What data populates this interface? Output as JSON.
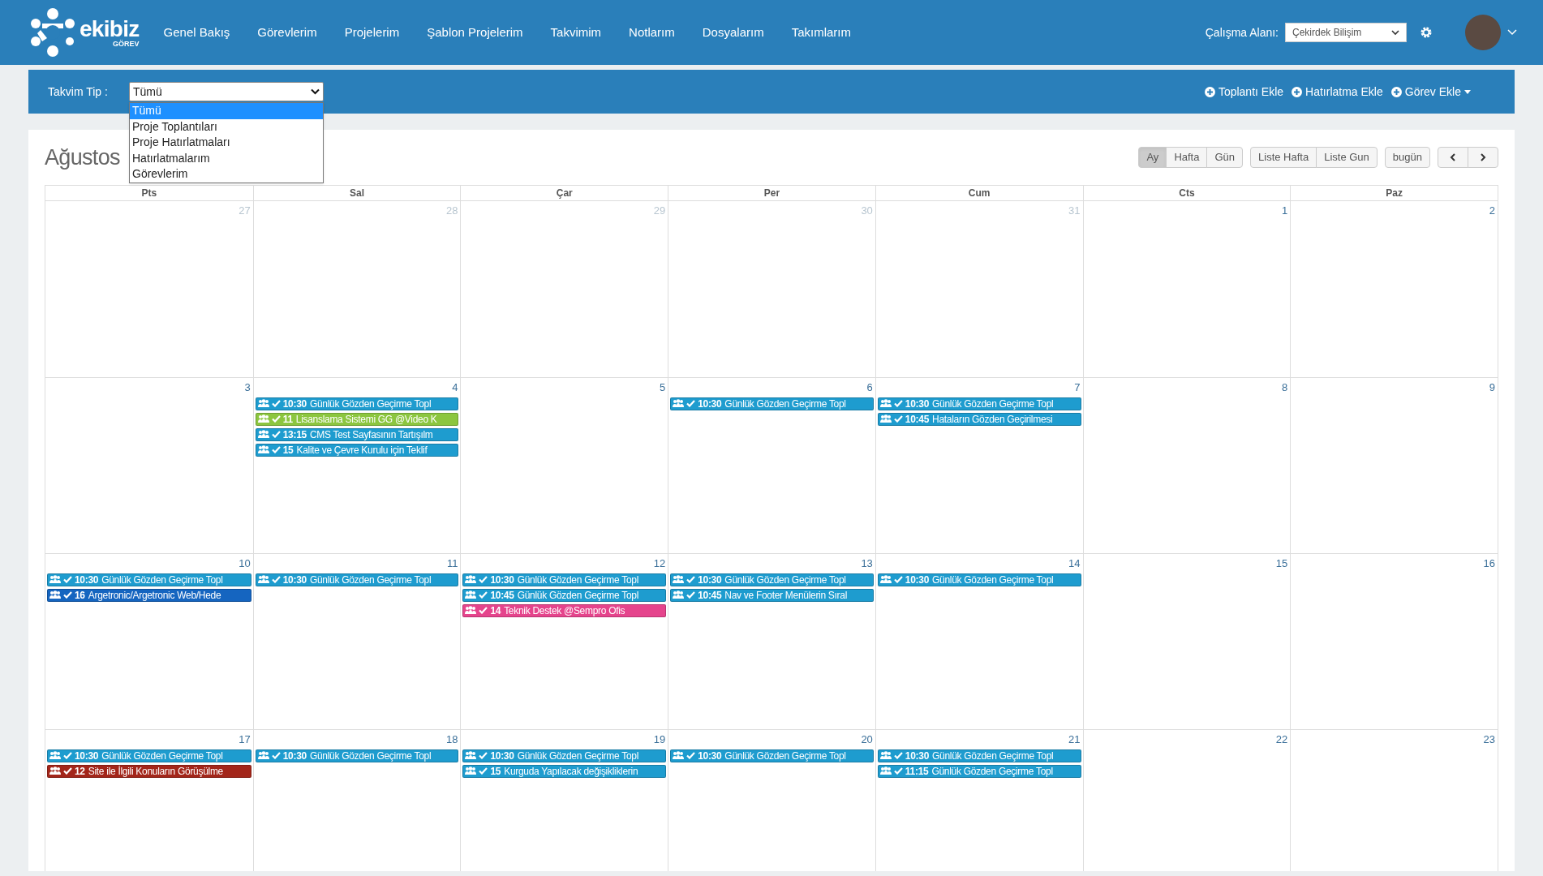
{
  "logo": {
    "name": "ekibiz",
    "subtitle": "GÖREV"
  },
  "nav": [
    {
      "label": "Genel Bakış"
    },
    {
      "label": "Görevlerim"
    },
    {
      "label": "Projelerim"
    },
    {
      "label": "Şablon Projelerim"
    },
    {
      "label": "Takvimim"
    },
    {
      "label": "Notlarım"
    },
    {
      "label": "Dosyalarım"
    },
    {
      "label": "Takımlarım"
    }
  ],
  "workspace": {
    "label": "Çalışma Alanı:",
    "value": "Çekirdek Bilişim"
  },
  "toolbar": {
    "label": "Takvim Tip :",
    "select_value": "Tümü",
    "options": [
      {
        "label": "Tümü",
        "selected": true
      },
      {
        "label": "Proje Toplantıları",
        "selected": false
      },
      {
        "label": "Proje Hatırlatmaları",
        "selected": false
      },
      {
        "label": "Hatırlatmalarım",
        "selected": false
      },
      {
        "label": "Görevlerim",
        "selected": false
      }
    ],
    "actions": [
      {
        "label": "Toplantı Ekle",
        "dropdown": false
      },
      {
        "label": "Hatırlatma Ekle",
        "dropdown": false
      },
      {
        "label": "Görev Ekle",
        "dropdown": true
      }
    ]
  },
  "calendar": {
    "title": "Ağustos",
    "button_groups": [
      [
        {
          "label": "Ay",
          "kind": "text",
          "selected": true
        },
        {
          "label": "Hafta",
          "kind": "text",
          "selected": false
        },
        {
          "label": "Gün",
          "kind": "text",
          "selected": false
        }
      ],
      [
        {
          "label": "Liste Hafta",
          "kind": "text",
          "selected": false
        },
        {
          "label": "Liste Gun",
          "kind": "text",
          "selected": false
        }
      ],
      [
        {
          "label": "bugün",
          "kind": "text",
          "selected": false
        }
      ],
      [
        {
          "kind": "prev",
          "selected": false
        },
        {
          "kind": "next",
          "selected": false
        }
      ]
    ],
    "weekdays": [
      "Pts",
      "Sal",
      "Çar",
      "Per",
      "Cum",
      "Cts",
      "Paz"
    ],
    "weeks": [
      {
        "days": [
          {
            "number": "27",
            "other_month": true
          },
          {
            "number": "28",
            "other_month": true
          },
          {
            "number": "29",
            "other_month": true
          },
          {
            "number": "30",
            "other_month": true
          },
          {
            "number": "31",
            "other_month": true
          },
          {
            "number": "1",
            "other_month": false
          },
          {
            "number": "2",
            "other_month": false
          }
        ]
      },
      {
        "days": [
          {
            "number": "3",
            "other_month": false
          },
          {
            "number": "4",
            "other_month": false,
            "events": [
              {
                "time": "10:30",
                "title": "Günlük Gözden Geçirme Topl",
                "color": "#1e9ccf"
              },
              {
                "time": "11",
                "title": "Lisanslama Sistemi GG @Video K",
                "color": "#8cc63f"
              },
              {
                "time": "13:15",
                "title": "CMS Test Sayfasının Tartışılm",
                "color": "#1e9ccf"
              },
              {
                "time": "15",
                "title": "Kalite ve Çevre Kurulu için Teklif",
                "color": "#1e9ccf"
              }
            ]
          },
          {
            "number": "5",
            "other_month": false
          },
          {
            "number": "6",
            "other_month": false,
            "events": [
              {
                "time": "10:30",
                "title": "Günlük Gözden Geçirme Topl",
                "color": "#1e9ccf"
              }
            ]
          },
          {
            "number": "7",
            "other_month": false,
            "events": [
              {
                "time": "10:30",
                "title": "Günlük Gözden Geçirme Topl",
                "color": "#1e9ccf"
              },
              {
                "time": "10:45",
                "title": "Hataların Gözden Geçirilmesi",
                "color": "#1e9ccf"
              }
            ]
          },
          {
            "number": "8",
            "other_month": false
          },
          {
            "number": "9",
            "other_month": false
          }
        ]
      },
      {
        "days": [
          {
            "number": "10",
            "other_month": false,
            "events": [
              {
                "time": "10:30",
                "title": "Günlük Gözden Geçirme Topl",
                "color": "#1e9ccf"
              },
              {
                "time": "16",
                "title": "Argetronic/Argetronic Web/Hede",
                "color": "#1565c0"
              }
            ]
          },
          {
            "number": "11",
            "other_month": false,
            "events": [
              {
                "time": "10:30",
                "title": "Günlük Gözden Geçirme Topl",
                "color": "#1e9ccf"
              }
            ]
          },
          {
            "number": "12",
            "other_month": false,
            "events": [
              {
                "time": "10:30",
                "title": "Günlük Gözden Geçirme Topl",
                "color": "#1e9ccf"
              },
              {
                "time": "10:45",
                "title": "Günlük Gözden Geçirme Topl",
                "color": "#1e9ccf"
              },
              {
                "time": "14",
                "title": "Teknik Destek @Sempro Ofis",
                "color": "#e5448c"
              }
            ]
          },
          {
            "number": "13",
            "other_month": false,
            "events": [
              {
                "time": "10:30",
                "title": "Günlük Gözden Geçirme Topl",
                "color": "#1e9ccf"
              },
              {
                "time": "10:45",
                "title": "Nav ve Footer Menülerin Sıral",
                "color": "#1e9ccf"
              }
            ]
          },
          {
            "number": "14",
            "other_month": false,
            "events": [
              {
                "time": "10:30",
                "title": "Günlük Gözden Geçirme Topl",
                "color": "#1e9ccf"
              }
            ]
          },
          {
            "number": "15",
            "other_month": false
          },
          {
            "number": "16",
            "other_month": false
          }
        ]
      },
      {
        "days": [
          {
            "number": "17",
            "other_month": false,
            "events": [
              {
                "time": "10:30",
                "title": "Günlük Gözden Geçirme Topl",
                "color": "#1e9ccf"
              },
              {
                "time": "12",
                "title": "Site ile İlgili Konuların Görüşülme",
                "color": "#a3261a"
              }
            ]
          },
          {
            "number": "18",
            "other_month": false,
            "events": [
              {
                "time": "10:30",
                "title": "Günlük Gözden Geçirme Topl",
                "color": "#1e9ccf"
              }
            ]
          },
          {
            "number": "19",
            "other_month": false,
            "events": [
              {
                "time": "10:30",
                "title": "Günlük Gözden Geçirme Topl",
                "color": "#1e9ccf"
              },
              {
                "time": "15",
                "title": "Kurguda Yapılacak değişikliklerin",
                "color": "#1e9ccf"
              }
            ]
          },
          {
            "number": "20",
            "other_month": false,
            "events": [
              {
                "time": "10:30",
                "title": "Günlük Gözden Geçirme Topl",
                "color": "#1e9ccf"
              }
            ]
          },
          {
            "number": "21",
            "other_month": false,
            "events": [
              {
                "time": "10:30",
                "title": "Günlük Gözden Geçirme Topl",
                "color": "#1e9ccf"
              },
              {
                "time": "11:15",
                "title": "Günlük Gözden Geçirme Topl",
                "color": "#1e9ccf"
              }
            ]
          },
          {
            "number": "22",
            "other_month": false
          },
          {
            "number": "23",
            "other_month": false
          }
        ]
      }
    ]
  }
}
